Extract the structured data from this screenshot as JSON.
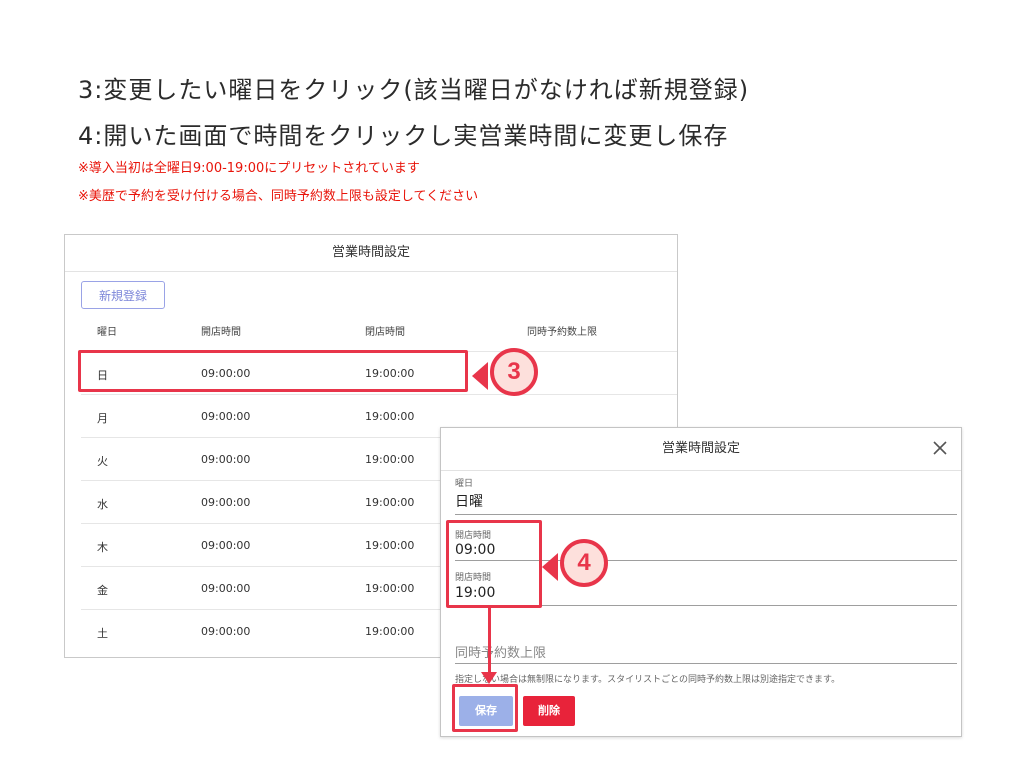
{
  "instructions": {
    "line1": "3:変更したい曜日をクリック(該当曜日がなければ新規登録)",
    "line2": "4:開いた画面で時間をクリックし実営業時間に変更し保存",
    "note1": "※導入当初は全曜日9:00-19:00にプリセットされています",
    "note2": "※美歴で予約を受け付ける場合、同時予約数上限も設定してください"
  },
  "panel": {
    "title": "営業時間設定",
    "new_button": "新規登録",
    "columns": [
      "曜日",
      "開店時間",
      "閉店時間",
      "同時予約数上限"
    ],
    "rows": [
      {
        "day": "日",
        "open": "09:00:00",
        "close": "19:00:00"
      },
      {
        "day": "月",
        "open": "09:00:00",
        "close": "19:00:00"
      },
      {
        "day": "火",
        "open": "09:00:00",
        "close": "19:00:00"
      },
      {
        "day": "水",
        "open": "09:00:00",
        "close": "19:00:00"
      },
      {
        "day": "木",
        "open": "09:00:00",
        "close": "19:00:00"
      },
      {
        "day": "金",
        "open": "09:00:00",
        "close": "19:00:00"
      },
      {
        "day": "土",
        "open": "09:00:00",
        "close": "19:00:00"
      }
    ]
  },
  "badges": {
    "step3": "3",
    "step4": "4"
  },
  "modal": {
    "title": "営業時間設定",
    "close_icon": "close-icon",
    "day_label": "曜日",
    "day_value": "日曜",
    "open_label": "開店時間",
    "open_value": "09:00",
    "close_label": "閉店時間",
    "close_value": "19:00",
    "limit_label": "同時予約数上限",
    "hint": "指定しない場合は無制限になります。スタイリストごとの同時予約数上限は別途指定できます。",
    "save_button": "保存",
    "delete_button": "削除"
  },
  "colors": {
    "accent_red": "#e8354a",
    "save_blue": "#9cb0e8",
    "delete_red": "#e8233a",
    "note_red": "#e8140a"
  }
}
